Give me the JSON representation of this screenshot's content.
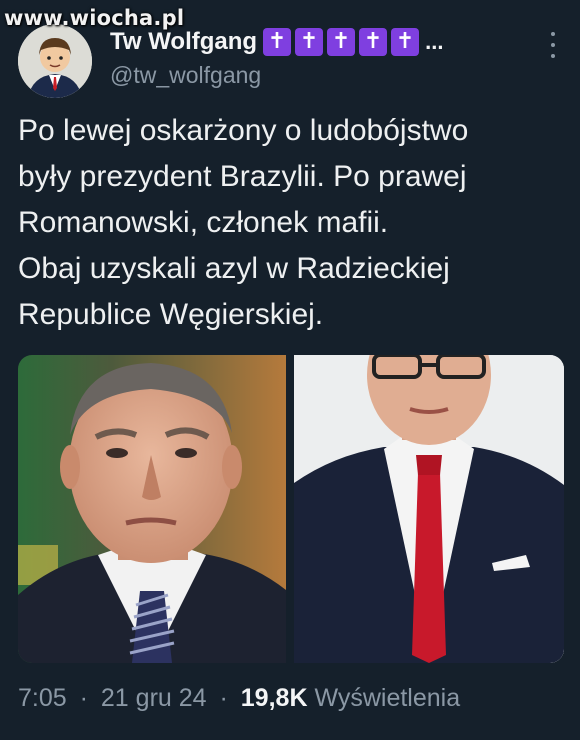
{
  "watermark": "www.wiocha.pl",
  "tweet": {
    "display_name": "Tw Wolfgang",
    "name_badges": [
      "✝",
      "✝",
      "✝",
      "✝",
      "✝"
    ],
    "name_ellipsis": "...",
    "handle": "@tw_wolfgang",
    "text_lines": [
      "Po lewej oskarżony o ludobójstwo",
      "były prezydent Brazylii. Po prawej",
      "Romanowski, członek mafii.",
      "Obaj uzyskali azyl w Radzieckiej",
      "Republice Węgierskiej."
    ],
    "time": "7:05",
    "date": "21 gru 24",
    "separator": "·",
    "views_count": "19,8K",
    "views_label": "Wyświetlenia"
  },
  "icons": {
    "more": "more-vertical-icon"
  },
  "colors": {
    "background": "#15202b",
    "text": "#e7e9ea",
    "secondary_text": "#8b98a5",
    "badge": "#7f3fe0"
  }
}
